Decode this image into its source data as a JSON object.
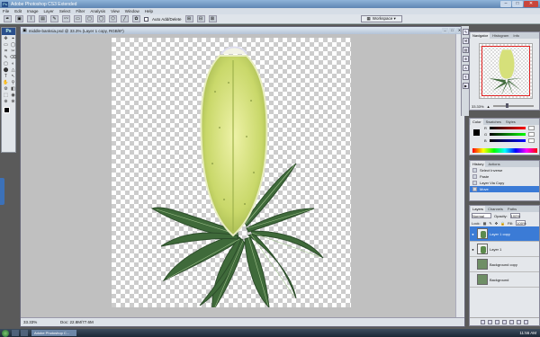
{
  "app": {
    "title": "Adobe Photoshop CS3 Extended"
  },
  "window_controls": {
    "minimize": "–",
    "maximize": "□",
    "close": "✕"
  },
  "menu": [
    "File",
    "Edit",
    "Image",
    "Layer",
    "Select",
    "Filter",
    "Analysis",
    "View",
    "Window",
    "Help"
  ],
  "options": {
    "auto_add_delete_label": "Auto Add/Delete",
    "workspace_label": "Workspace ▾"
  },
  "tools": [
    "✥",
    "⌖",
    "▭",
    "◯",
    "⌗",
    "✂",
    "✎",
    "⌫",
    "▢",
    "◐",
    "⬤",
    "△",
    "T",
    "↖",
    "✋",
    "⚲",
    "⚙",
    "◧",
    "⬚",
    "◉",
    "⊕",
    "⊗"
  ],
  "document": {
    "title": "middle-banksia.psd @ 33.3% (Layer 1 copy, RGB/8*)",
    "zoom": "33.33%",
    "doc_info": "Doc: 22.8M/77.6M"
  },
  "panels": {
    "navigator": {
      "tabs": [
        "Navigator",
        "Histogram",
        "Info"
      ],
      "zoom": "33.33%"
    },
    "color": {
      "tabs": [
        "Color",
        "Swatches",
        "Styles"
      ],
      "channels": [
        "R",
        "G",
        "B"
      ]
    },
    "history": {
      "tabs": [
        "History",
        "Actions"
      ],
      "items": [
        "Select Inverse",
        "Paste",
        "Layer Via Copy",
        "Move"
      ]
    },
    "layers": {
      "tabs": [
        "Layers",
        "Channels",
        "Paths"
      ],
      "blend_mode": "Normal",
      "opacity_label": "Opacity:",
      "opacity": "100%",
      "lock_label": "Lock:",
      "fill_label": "Fill:",
      "fill": "100%",
      "items": [
        {
          "name": "Layer 1 copy",
          "visible": true,
          "selected": true,
          "thumb": "plant"
        },
        {
          "name": "Layer 1",
          "visible": true,
          "selected": false,
          "thumb": "plant"
        },
        {
          "name": "Background copy",
          "visible": false,
          "selected": false,
          "thumb": "bgimg"
        },
        {
          "name": "Background",
          "visible": false,
          "selected": false,
          "thumb": "bgimg"
        }
      ]
    }
  },
  "taskbar": {
    "app_label": "Adobe Photoshop C...",
    "clock": "11:56 AM"
  },
  "colors": {
    "accent": "#3b7bd6",
    "leaf": "#3f6a3a",
    "cone": "#d6e07a"
  }
}
